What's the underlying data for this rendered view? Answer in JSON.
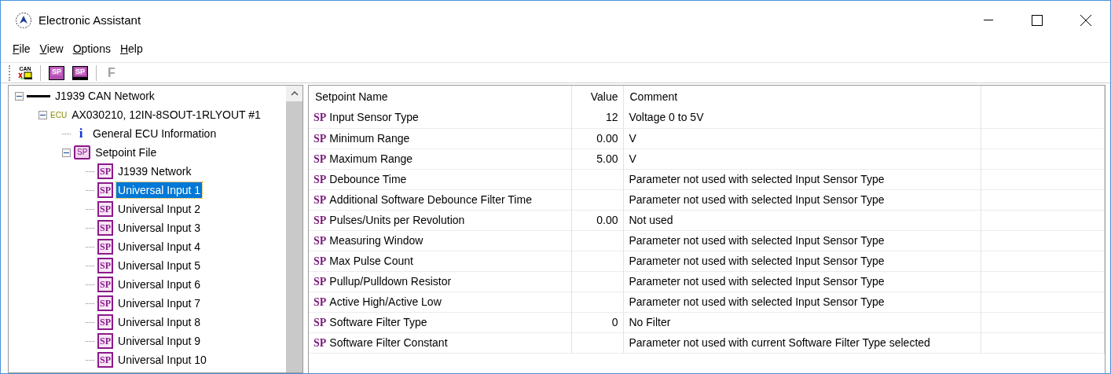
{
  "window": {
    "title": "Electronic Assistant"
  },
  "menu": [
    {
      "label": "File"
    },
    {
      "label": "View"
    },
    {
      "label": "Options"
    },
    {
      "label": "Help"
    }
  ],
  "toolbar": [
    {
      "kind": "can",
      "icon_text": "CAN"
    },
    {
      "kind": "open",
      "icon_text": "SP"
    },
    {
      "kind": "save",
      "icon_text": "SP"
    },
    {
      "kind": "letter",
      "label": "F",
      "disabled": true
    }
  ],
  "tree": [
    {
      "label": "J1939 CAN Network",
      "kind": "network",
      "expanded": true,
      "selected": false,
      "children": [
        {
          "label": "AX030210, 12IN-8SOUT-1RLYOUT #1",
          "kind": "ecu",
          "icon_text": "ECU",
          "expanded": true,
          "selected": false,
          "children": [
            {
              "label": "General ECU Information",
              "kind": "info",
              "icon_text": "i",
              "selected": false
            },
            {
              "label": "Setpoint File",
              "kind": "sp_file",
              "icon_text": "SP",
              "expanded": true,
              "selected": false,
              "children": [
                {
                  "label": "J1939 Network",
                  "kind": "sp",
                  "icon_text": "SP",
                  "selected": false
                },
                {
                  "label": "Universal Input 1",
                  "kind": "sp",
                  "icon_text": "SP",
                  "selected": true
                },
                {
                  "label": "Universal Input 2",
                  "kind": "sp",
                  "icon_text": "SP",
                  "selected": false
                },
                {
                  "label": "Universal Input 3",
                  "kind": "sp",
                  "icon_text": "SP",
                  "selected": false
                },
                {
                  "label": "Universal Input 4",
                  "kind": "sp",
                  "icon_text": "SP",
                  "selected": false
                },
                {
                  "label": "Universal Input 5",
                  "kind": "sp",
                  "icon_text": "SP",
                  "selected": false
                },
                {
                  "label": "Universal Input 6",
                  "kind": "sp",
                  "icon_text": "SP",
                  "selected": false
                },
                {
                  "label": "Universal Input 7",
                  "kind": "sp",
                  "icon_text": "SP",
                  "selected": false
                },
                {
                  "label": "Universal Input 8",
                  "kind": "sp",
                  "icon_text": "SP",
                  "selected": false
                },
                {
                  "label": "Universal Input 9",
                  "kind": "sp",
                  "icon_text": "SP",
                  "selected": false
                },
                {
                  "label": "Universal Input 10",
                  "kind": "sp",
                  "icon_text": "SP",
                  "selected": false
                }
              ]
            }
          ]
        }
      ]
    }
  ],
  "table": {
    "columns": [
      "Setpoint Name",
      "Value",
      "Comment"
    ],
    "rows": [
      {
        "badge": "SP",
        "name": "Input Sensor Type",
        "value": "12",
        "comment": "Voltage 0 to 5V"
      },
      {
        "badge": "SP",
        "name": "Minimum Range",
        "value": "0.00",
        "comment": "V"
      },
      {
        "badge": "SP",
        "name": "Maximum Range",
        "value": "5.00",
        "comment": "V"
      },
      {
        "badge": "SP",
        "name": "Debounce Time",
        "comment": "Parameter not used with selected Input Sensor Type"
      },
      {
        "badge": "SP",
        "name": "Additional Software Debounce Filter Time",
        "comment": "Parameter not used with selected Input Sensor Type"
      },
      {
        "badge": "SP",
        "name": "Pulses/Units per Revolution",
        "value": "0.00",
        "comment": "Not used"
      },
      {
        "badge": "SP",
        "name": "Measuring Window",
        "comment": "Parameter not used with selected Input Sensor Type"
      },
      {
        "badge": "SP",
        "name": "Max Pulse Count",
        "comment": "Parameter not used with selected Input Sensor Type"
      },
      {
        "badge": "SP",
        "name": "Pullup/Pulldown Resistor",
        "comment": "Parameter not used with selected Input Sensor Type"
      },
      {
        "badge": "SP",
        "name": "Active High/Active Low",
        "comment": "Parameter not used with selected Input Sensor Type"
      },
      {
        "badge": "SP",
        "name": "Software Filter Type",
        "value": "0",
        "comment": "No Filter"
      },
      {
        "badge": "SP",
        "name": "Software Filter Constant",
        "comment": "Parameter not used with current Software Filter Type selected"
      }
    ]
  }
}
